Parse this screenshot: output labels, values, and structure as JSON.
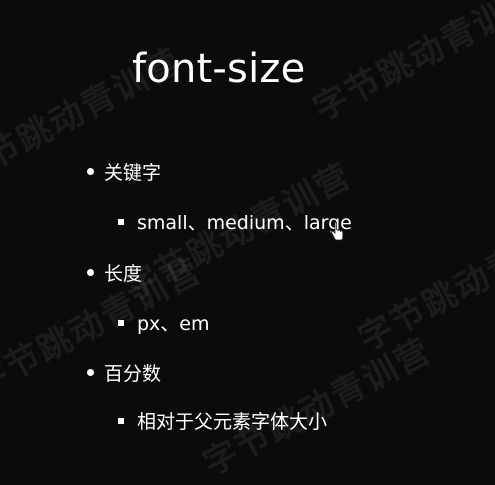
{
  "slide": {
    "title": "font-size",
    "items": [
      {
        "label": "关键字",
        "sub": "small、medium、large"
      },
      {
        "label": "长度",
        "sub": "px、em"
      },
      {
        "label": "百分数",
        "sub": "相对于父元素字体大小"
      }
    ]
  },
  "watermark": {
    "text": "字节跳动青训营"
  },
  "icons": {
    "cursor": "hand-pointer-icon",
    "bullet_level1": "round-bullet-icon",
    "bullet_level2": "square-bullet-icon"
  }
}
